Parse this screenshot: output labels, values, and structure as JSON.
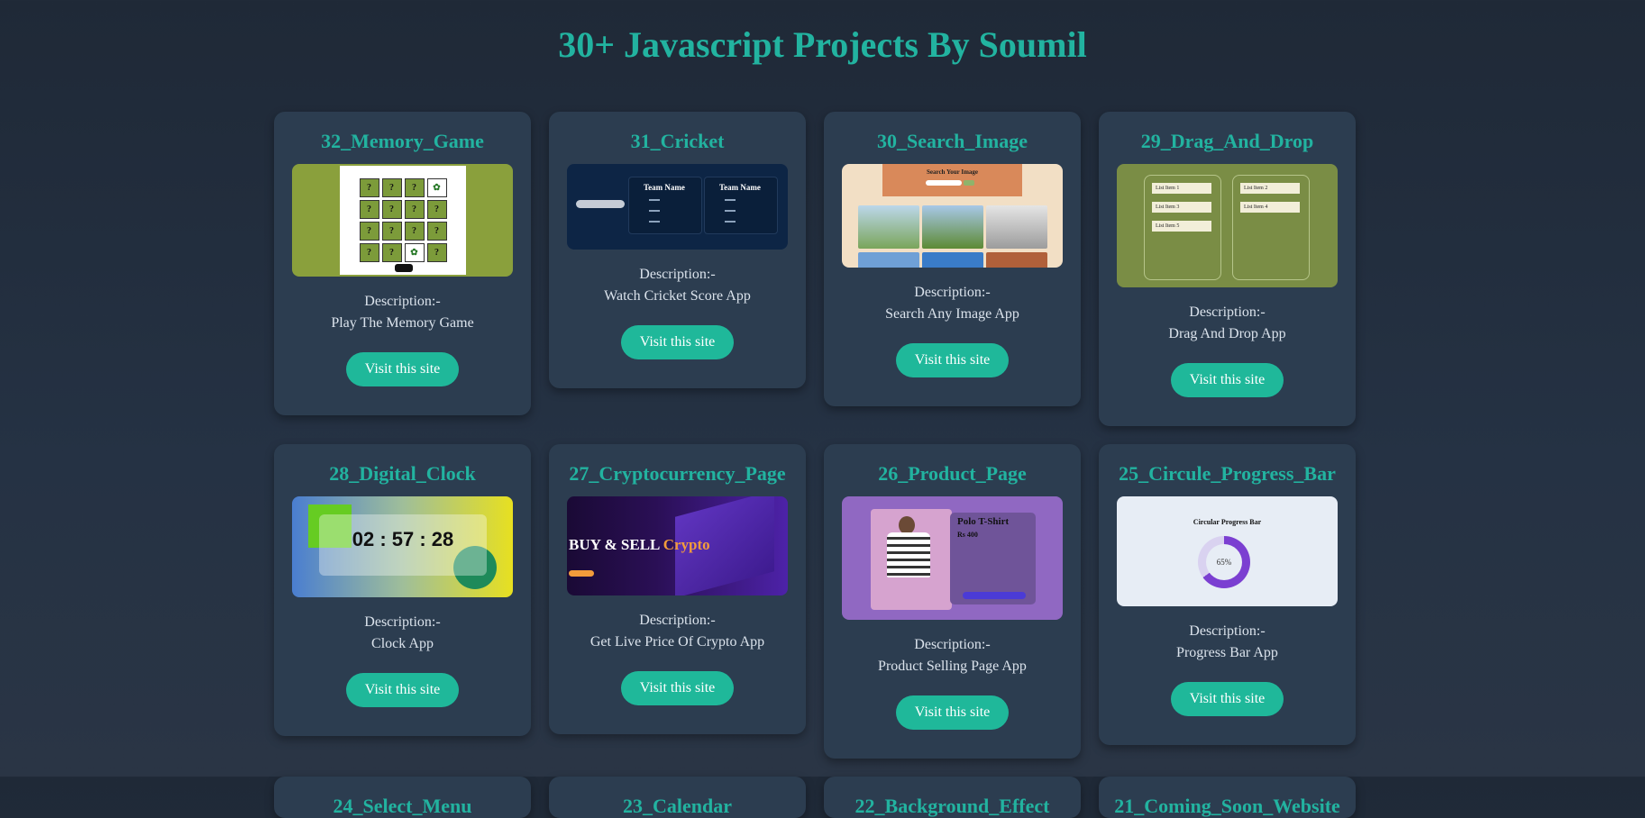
{
  "page_title": "30+ Javascript Projects By Soumil",
  "button_label": "Visit this site",
  "description_label": "Description:-",
  "projects": [
    {
      "title": "32_Memory_Game",
      "description": "Play The Memory Game"
    },
    {
      "title": "31_Cricket",
      "description": "Watch Cricket Score App"
    },
    {
      "title": "30_Search_Image",
      "description": "Search Any Image App"
    },
    {
      "title": "29_Drag_And_Drop",
      "description": "Drag And Drop App"
    },
    {
      "title": "28_Digital_Clock",
      "description": "Clock App"
    },
    {
      "title": "27_Cryptocurrency_Page",
      "description": "Get Live Price Of Crypto App"
    },
    {
      "title": "26_Product_Page",
      "description": "Product Selling Page App"
    },
    {
      "title": "25_Circule_Progress_Bar",
      "description": "Progress Bar App"
    },
    {
      "title": "24_Select_Menu"
    },
    {
      "title": "23_Calendar"
    },
    {
      "title": "22_Background_Effect"
    },
    {
      "title": "21_Coming_Soon_Website"
    }
  ],
  "previews": {
    "cricket_team": "Team Name",
    "search_header": "Search Your Image",
    "drag_items": [
      "List Item 1",
      "List Item 3",
      "List Item 5",
      "List Item 2",
      "List Item 4"
    ],
    "clock_time": "02 : 57 : 28",
    "crypto_heading": "BUY & SELL",
    "crypto_accent": "Crypto",
    "product_name": "Polo T-Shirt",
    "product_price": "Rs 400",
    "progress_title": "Circular Progress Bar",
    "progress_value": "65%"
  },
  "colors": {
    "accent": "#22b3a0",
    "button": "#1fb89a",
    "card": "#2c3d50",
    "background": "#1f2937"
  }
}
